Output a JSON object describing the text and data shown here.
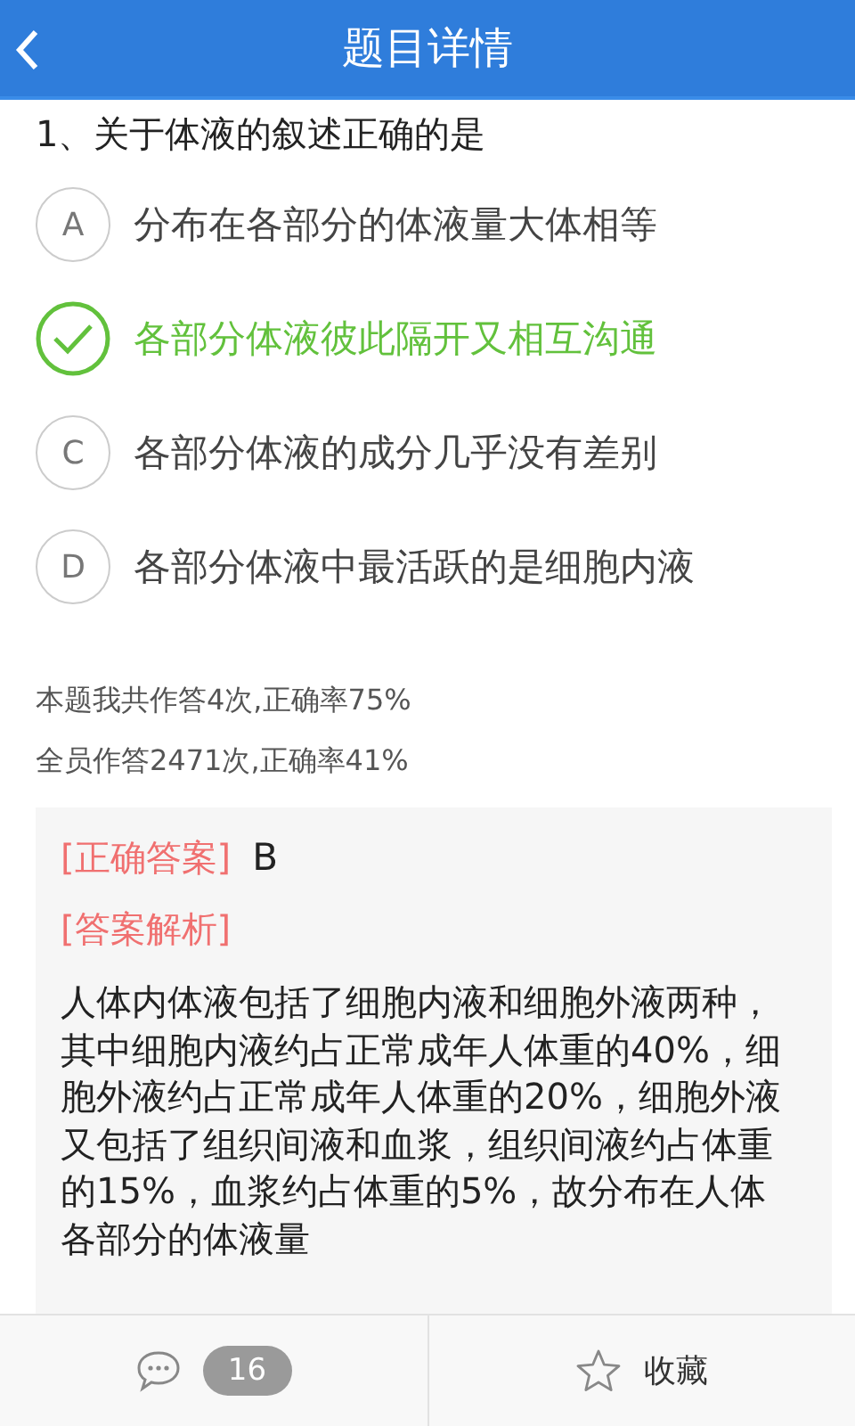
{
  "header": {
    "title": "题目详情"
  },
  "question": {
    "text": "1、关于体液的叙述正确的是"
  },
  "options": [
    {
      "letter": "A",
      "text": "分布在各部分的体液量大体相等",
      "selected": false
    },
    {
      "text": "各部分体液彼此隔开又相互沟通",
      "selected": true
    },
    {
      "letter": "C",
      "text": "各部分体液的成分几乎没有差别",
      "selected": false
    },
    {
      "letter": "D",
      "text": "各部分体液中最活跃的是细胞内液",
      "selected": false
    }
  ],
  "stats": [
    "本题我共作答4次,正确率75%",
    "全员作答2471次,正确率41%"
  ],
  "answer": {
    "label": "[正确答案]",
    "value": "B",
    "analysis_label": "[答案解析]",
    "analysis": "人体内体液包括了细胞内液和细胞外液两种，其中细胞内液约占正常成年人体重的40%，细胞外液约占正常成年人体重的20%，细胞外液又包括了组织间液和血浆，组织间液约占体重的15%，血浆约占体重的5%，故分布在人体各部分的体液量"
  },
  "footer": {
    "comment_count": "16",
    "favorite_label": "收藏"
  }
}
